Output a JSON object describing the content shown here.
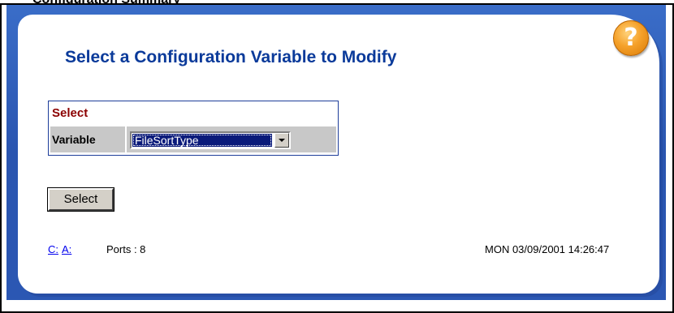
{
  "top_strip_text": "Configuration Summary",
  "page": {
    "title": "Select a Configuration Variable to Modify",
    "help_icon": "question-mark-icon"
  },
  "select_section": {
    "header": "Select",
    "variable_label": "Variable",
    "dropdown_value": "FileSortType"
  },
  "actions": {
    "select_button_label": "Select"
  },
  "footer": {
    "drive_links": [
      "C:",
      "A:"
    ],
    "ports": "Ports : 8",
    "timestamp": "MON 03/09/2001 14:26:47"
  },
  "colors": {
    "title": "#0a3a9a",
    "section_header": "#8b0000",
    "frame_blue": "#2a55b0",
    "help_orange": "#f5a12a"
  }
}
